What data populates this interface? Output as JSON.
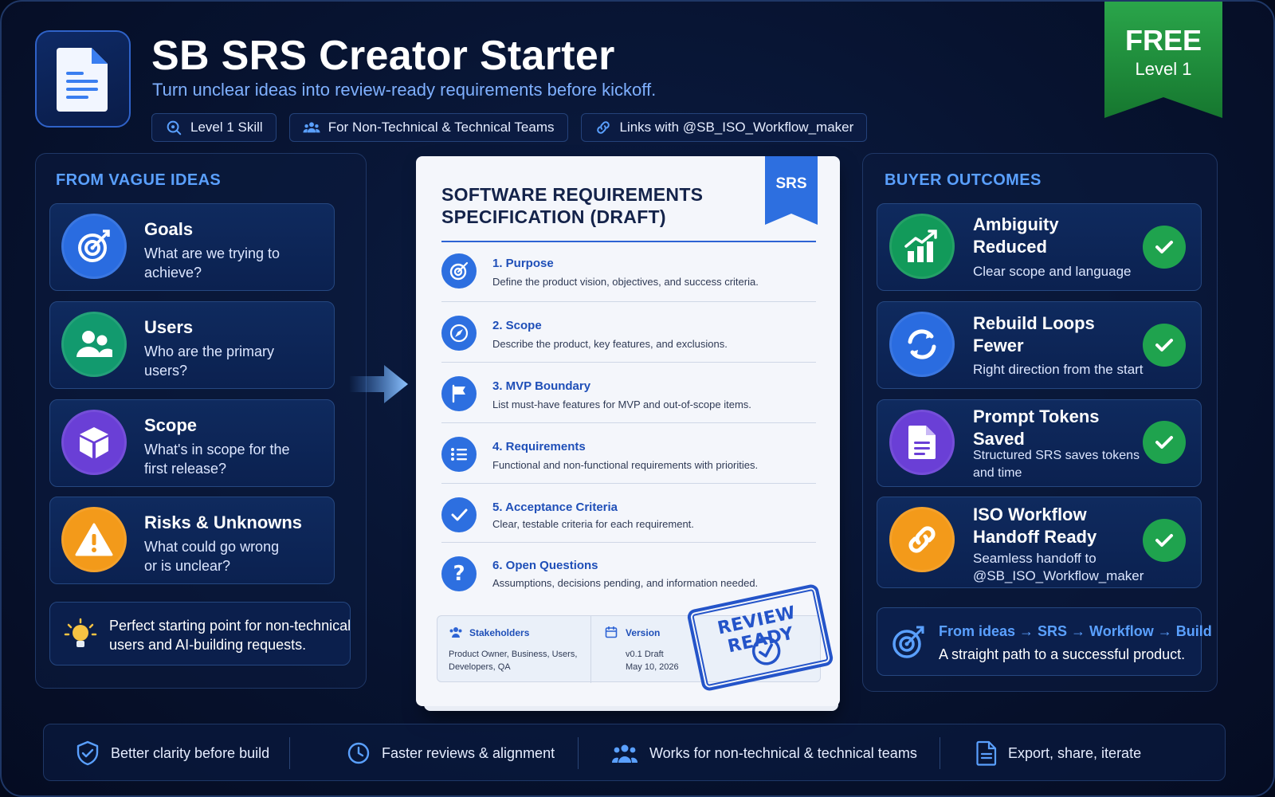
{
  "header": {
    "title": "SB SRS Creator Starter",
    "subtitle": "Turn unclear ideas into review-ready requirements before kickoff.",
    "tags": [
      "Level 1 Skill",
      "For Non-Technical & Technical Teams",
      "Links with @SB_ISO_Workflow_maker"
    ]
  },
  "ribbon": {
    "line1": "FREE",
    "line2": "Level 1"
  },
  "left_panel": {
    "heading": "FROM VAGUE IDEAS",
    "cards": [
      {
        "title": "Goals",
        "desc_l1": "What are we trying to",
        "desc_l2": "achieve?",
        "icon": "target-icon",
        "color": "#2a6ce0"
      },
      {
        "title": "Users",
        "desc_l1": "Who are the primary",
        "desc_l2": "users?",
        "icon": "users-icon",
        "color": "#129a6e"
      },
      {
        "title": "Scope",
        "desc_l1": "What's in scope for the",
        "desc_l2": "first release?",
        "icon": "cube-icon",
        "color": "#6a3fd6"
      },
      {
        "title": "Risks & Unknowns",
        "desc_l1": "What could go wrong",
        "desc_l2": "or is unclear?",
        "icon": "warning-icon",
        "color": "#f39a1a"
      }
    ],
    "tip_l1": "Perfect starting point for non-technical",
    "tip_l2": "users and AI-building requests."
  },
  "document": {
    "title_l1": "SOFTWARE REQUIREMENTS",
    "title_l2": "SPECIFICATION (DRAFT)",
    "tag": "SRS",
    "sections": [
      {
        "title": "1.  Purpose",
        "desc": "Define the product vision, objectives, and success criteria.",
        "icon": "target-icon"
      },
      {
        "title": "2. Scope",
        "desc": "Describe the product, key features, and exclusions.",
        "icon": "compass-icon"
      },
      {
        "title": "3. MVP Boundary",
        "desc": "List must-have features for MVP and out-of-scope items.",
        "icon": "flag-icon"
      },
      {
        "title": "4. Requirements",
        "desc": "Functional and non-functional requirements with priorities.",
        "icon": "list-icon"
      },
      {
        "title": "5. Acceptance Criteria",
        "desc": "Clear, testable criteria for each requirement.",
        "icon": "check-icon"
      },
      {
        "title": "6. Open Questions",
        "desc": "Assumptions, decisions pending, and information needed.",
        "icon": "question-icon"
      }
    ],
    "stakeholders_label": "Stakeholders",
    "stakeholders_l1": "Product Owner, Business, Users,",
    "stakeholders_l2": "Developers, QA",
    "version_label": "Version",
    "version_value": "v0.1 Draft",
    "version_date": "May 10, 2026",
    "stamp": "REVIEW READY"
  },
  "right_panel": {
    "heading": "BUYER OUTCOMES",
    "cards": [
      {
        "title_l1": "Ambiguity",
        "title_l2": "Reduced",
        "desc_l1": "Clear scope and language",
        "desc_l2": "",
        "icon": "chart-icon",
        "color": "#129a5a"
      },
      {
        "title_l1": "Rebuild Loops",
        "title_l2": "Fewer",
        "desc_l1": "Right direction from the start",
        "desc_l2": "",
        "icon": "refresh-icon",
        "color": "#2a6ce0"
      },
      {
        "title_l1": "Prompt Tokens",
        "title_l2": "Saved",
        "desc_l1": "Structured SRS saves tokens",
        "desc_l2": "and time",
        "icon": "document-icon",
        "color": "#6a3fd6"
      },
      {
        "title_l1": "ISO Workflow",
        "title_l2": "Handoff Ready",
        "desc_l1": "Seamless handoff to",
        "desc_l2": "@SB_ISO_Workflow_maker",
        "icon": "link-icon",
        "color": "#f39a1a"
      }
    ],
    "path_title": "From ideas → SRS → Workflow → Build",
    "path_desc": "A straight path to a successful product."
  },
  "footer": [
    {
      "label": "Better clarity before build",
      "icon": "shield-check-icon"
    },
    {
      "label": "Faster reviews & alignment",
      "icon": "clock-icon"
    },
    {
      "label": "Works for non-technical & technical teams",
      "icon": "team-icon"
    },
    {
      "label": "Export, share, iterate",
      "icon": "file-icon"
    }
  ],
  "colors": {
    "accent": "#5aa0ff",
    "check": "#1fa34e",
    "ribbon": "#1e8a3c",
    "doc_blue": "#2d63d4"
  }
}
